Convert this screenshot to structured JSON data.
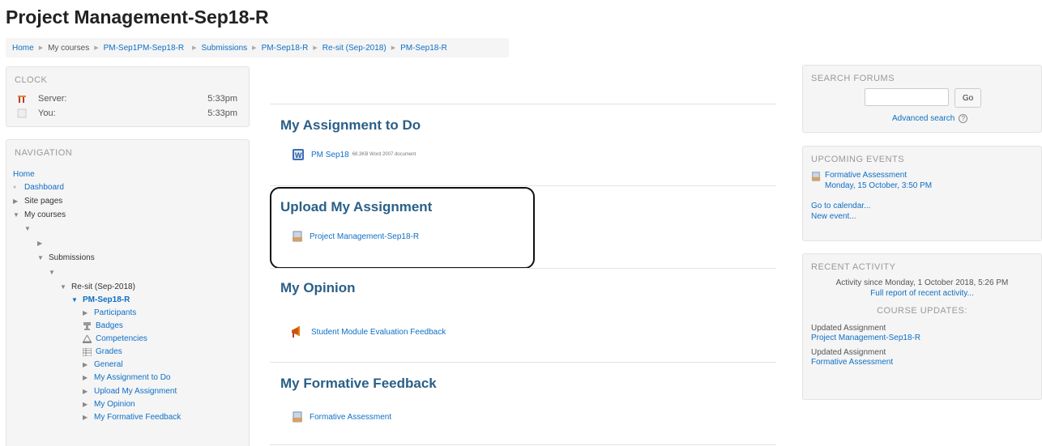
{
  "page": {
    "title": "Project Management-Sep18-R"
  },
  "breadcrumb": [
    "Home",
    "My courses",
    "PM-Sep1PM-Sep18-R",
    "Submissions",
    "PM-Sep18-R",
    "Re-sit (Sep-2018)",
    "PM-Sep18-R"
  ],
  "clock": {
    "title": "CLOCK",
    "server_label": "Server:",
    "server_time": "5:33pm",
    "you_label": "You:",
    "you_time": "5:33pm"
  },
  "navigation": {
    "title": "NAVIGATION",
    "home": "Home",
    "dashboard": "Dashboard",
    "site_pages": "Site pages",
    "my_courses": "My courses",
    "submissions": "Submissions",
    "resit": "Re-sit (Sep-2018)",
    "course": "PM-Sep18-R",
    "participants": "Participants",
    "badges": "Badges",
    "competencies": "Competencies",
    "grades": "Grades",
    "general": "General",
    "sec1": "My Assignment to Do",
    "sec2": "Upload My Assignment",
    "sec3": "My Opinion",
    "sec4": "My Formative Feedback"
  },
  "sections": [
    {
      "title": "My Assignment to Do",
      "activity": "PM Sep18",
      "meta": "68.3KB Word 2007 document"
    },
    {
      "title": "Upload My Assignment",
      "activity": "Project Management-Sep18-R"
    },
    {
      "title": "My Opinion",
      "activity": "Student Module Evaluation Feedback"
    },
    {
      "title": "My Formative Feedback",
      "activity": "Formative Assessment"
    }
  ],
  "search_forums": {
    "title": "SEARCH FORUMS",
    "button": "Go",
    "advanced": "Advanced search"
  },
  "upcoming_events": {
    "title": "UPCOMING EVENTS",
    "event_name": "Formative Assessment",
    "event_date": "Monday, 15 October, 3:50 PM",
    "calendar_link": "Go to calendar...",
    "new_event": "New event..."
  },
  "recent_activity": {
    "title": "RECENT ACTIVITY",
    "since": "Activity since Monday, 1 October 2018, 5:26 PM",
    "full_report": "Full report of recent activity...",
    "course_updates": "COURSE UPDATES:",
    "update1_label": "Updated Assignment",
    "update1_link": "Project Management-Sep18-R",
    "update2_label": "Updated Assignment",
    "update2_link": "Formative Assessment"
  },
  "colors": {
    "link": "#0f6fc5",
    "section_title": "#2a5f88",
    "block_bg": "#f5f5f5"
  }
}
